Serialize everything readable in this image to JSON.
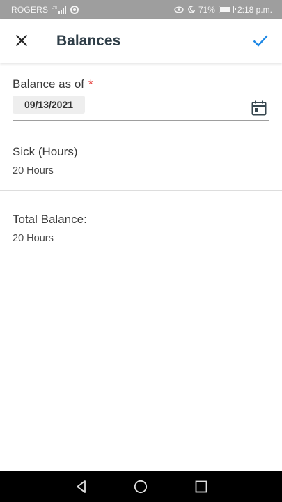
{
  "status_bar": {
    "carrier": "ROGERS",
    "battery": "71%",
    "time": "2:18 p.m."
  },
  "app_bar": {
    "title": "Balances",
    "close_icon": "close-icon",
    "confirm_icon": "check-icon"
  },
  "form": {
    "balance_as_of_label": "Balance as of",
    "required_mark": "*",
    "date_value": "09/13/2021",
    "calendar_icon": "calendar-icon"
  },
  "balances": [
    {
      "label": "Sick (Hours)",
      "value": "20 Hours"
    }
  ],
  "total": {
    "label": "Total Balance:",
    "value": "20 Hours"
  },
  "nav_bar": {
    "back_icon": "back-triangle-icon",
    "home_icon": "home-circle-icon",
    "recents_icon": "recents-square-icon"
  },
  "colors": {
    "accent": "#1e88e5",
    "title": "#2f3e48",
    "required": "#e53935",
    "status_bar": "#9e9e9e"
  }
}
